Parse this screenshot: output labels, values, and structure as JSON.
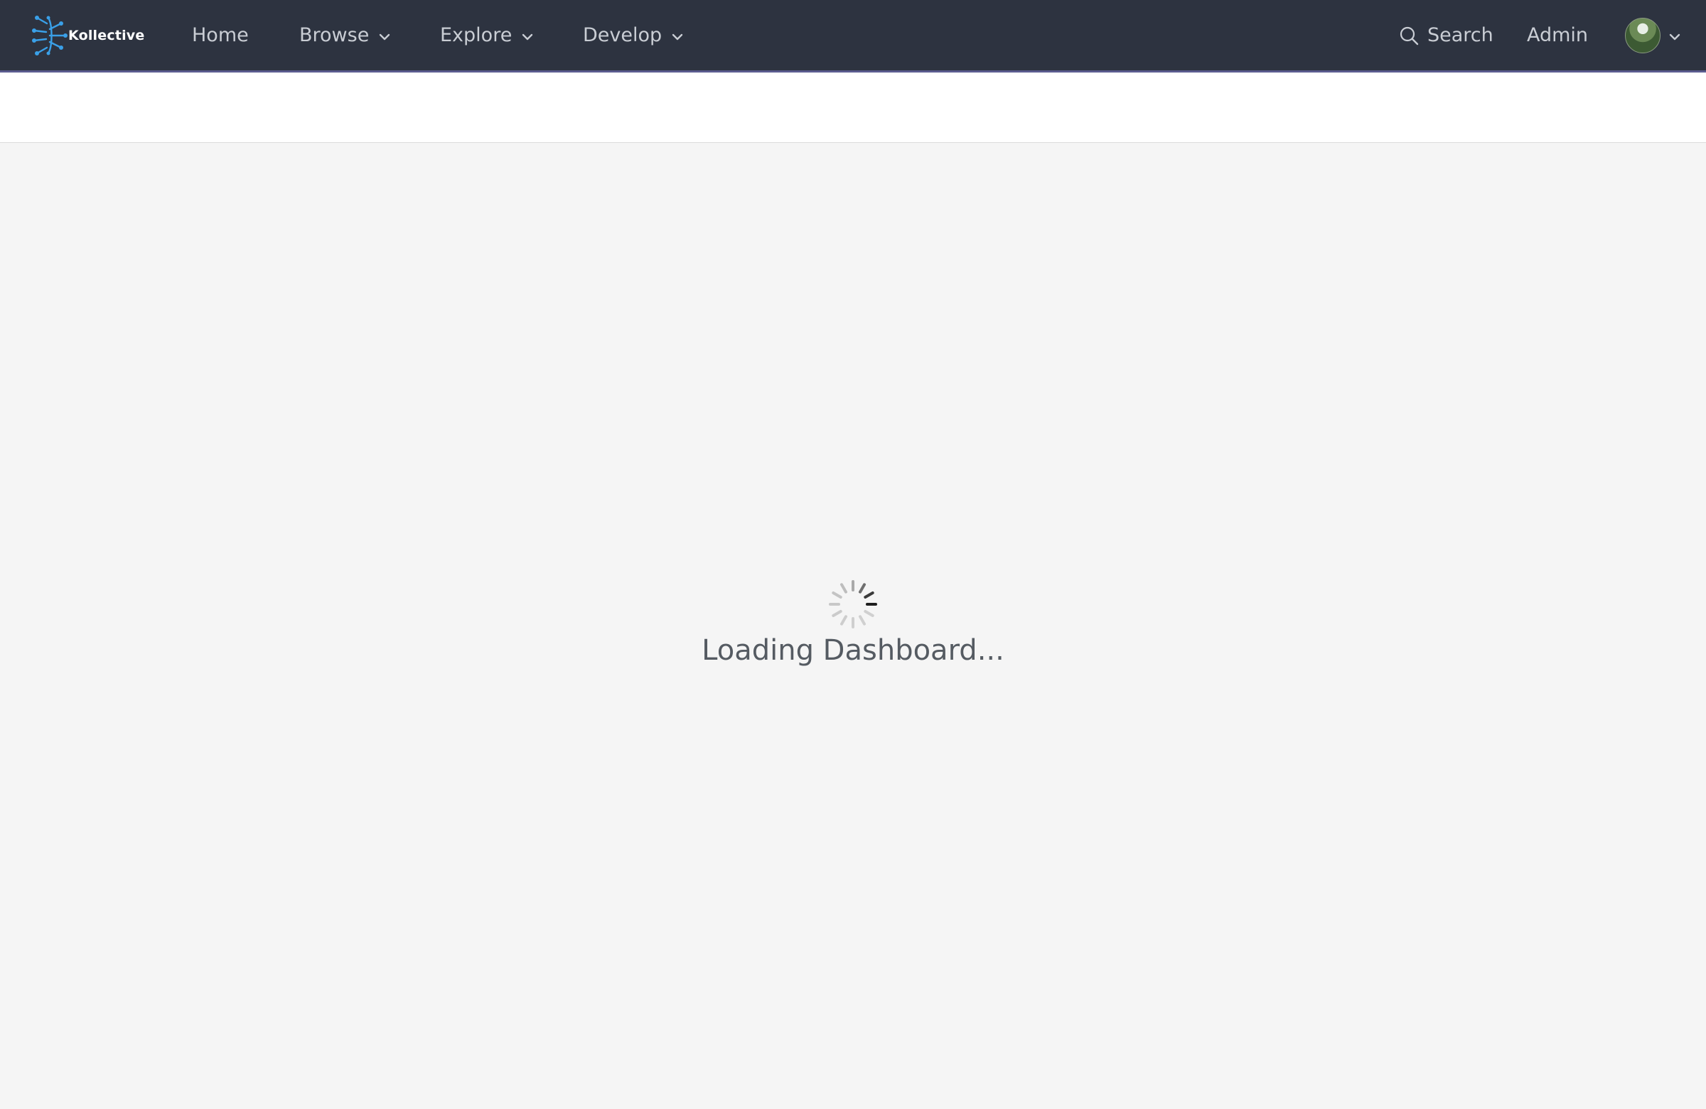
{
  "brand": {
    "name": "Kollective",
    "accent": "#3aa0e8"
  },
  "nav": {
    "items": [
      {
        "label": "Home",
        "has_dropdown": false
      },
      {
        "label": "Browse",
        "has_dropdown": true
      },
      {
        "label": "Explore",
        "has_dropdown": true
      },
      {
        "label": "Develop",
        "has_dropdown": true
      }
    ],
    "search_label": "Search",
    "admin_label": "Admin"
  },
  "loading": {
    "message": "Loading Dashboard..."
  },
  "colors": {
    "topbar": "#2d3340",
    "topbar_border": "#5b5c8f",
    "page_bg": "#f5f5f5"
  }
}
